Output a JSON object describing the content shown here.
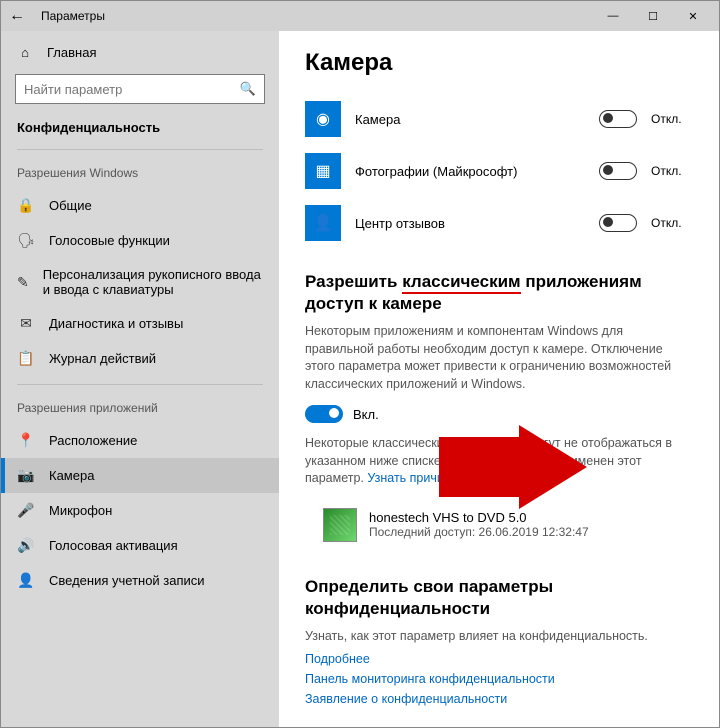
{
  "window": {
    "title": "Параметры"
  },
  "sidebar": {
    "home": "Главная",
    "search_placeholder": "Найти параметр",
    "section": "Конфиденциальность",
    "group1": "Разрешения Windows",
    "items1": [
      {
        "icon": "lock-icon",
        "glyph": "🔒",
        "label": "Общие"
      },
      {
        "icon": "voice-icon",
        "glyph": "🗣",
        "label": "Голосовые функции"
      },
      {
        "icon": "handwriting-icon",
        "glyph": "✎",
        "label": "Персонализация рукописного ввода и ввода с клавиатуры"
      },
      {
        "icon": "feedback-icon",
        "glyph": "✉",
        "label": "Диагностика и отзывы"
      },
      {
        "icon": "history-icon",
        "glyph": "📋",
        "label": "Журнал действий"
      }
    ],
    "group2": "Разрешения приложений",
    "items2": [
      {
        "icon": "location-icon",
        "glyph": "📍",
        "label": "Расположение",
        "selected": false
      },
      {
        "icon": "camera-icon",
        "glyph": "📷",
        "label": "Камера",
        "selected": true
      },
      {
        "icon": "microphone-icon",
        "glyph": "🎤",
        "label": "Микрофон",
        "selected": false
      },
      {
        "icon": "voice-activation-icon",
        "glyph": "🔊",
        "label": "Голосовая активация",
        "selected": false
      },
      {
        "icon": "account-icon",
        "glyph": "👤",
        "label": "Сведения учетной записи",
        "selected": false
      }
    ]
  },
  "main": {
    "heading": "Камера",
    "apps": [
      {
        "name": "Камера",
        "icon": "camera-app-icon",
        "glyph": "◉",
        "state": "Откл."
      },
      {
        "name": "Фотографии (Майкрософт)",
        "icon": "photos-app-icon",
        "glyph": "▦",
        "state": "Откл."
      },
      {
        "name": "Центр отзывов",
        "icon": "feedback-hub-icon",
        "glyph": "👤",
        "state": "Откл."
      }
    ],
    "section_title_a": "Разрешить ",
    "section_title_u": "классическим",
    "section_title_b": " приложениям доступ к камере",
    "desc1": "Некоторым приложениям и компонентам Windows для правильной работы необходим доступ к камере. Отключение этого параметра может привести к ограничению возможностей классических приложений и Windows.",
    "main_toggle_label": "Вкл.",
    "desc2_a": "Некоторые классические приложения могут не отображаться в указанном ниже списке или к ним не будет применен этот параметр. ",
    "desc2_link": "Узнать причину",
    "classic_app": {
      "name": "honestech VHS to DVD 5.0",
      "last_access": "Последний доступ: 26.06.2019 12:32:47"
    },
    "privacy_heading": "Определить свои параметры конфиденциальности",
    "privacy_desc": "Узнать, как этот параметр влияет на конфиденциальность.",
    "links": [
      "Подробнее",
      "Панель мониторинга конфиденциальности",
      "Заявление о конфиденциальности"
    ]
  }
}
